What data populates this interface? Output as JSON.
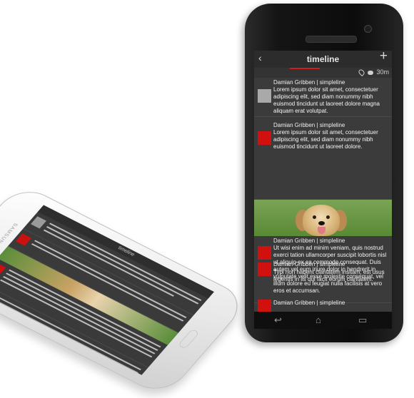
{
  "app": {
    "title": "timeline",
    "back_icon": "back-arrow-icon",
    "add_label": "+",
    "meta_time": "30m"
  },
  "posts": [
    {
      "author": "Damian Gribben | simpleline",
      "text": "Lorem ipsum dolor sit amet, consectetuer adipiscing elit, sed diam nonummy nibh euismod tincidunt ut laoreet dolore magna aliquam erat volutpat.",
      "avatar": "grey"
    },
    {
      "author": "Damian Gribben | simpleline",
      "text": "Lorem ipsum dolor sit amet, consectetuer adipiscing elit, sed diam nonummy nibh euismod tincidunt ut laoreet dolore.",
      "avatar": "red"
    },
    {
      "author": "Damian Gribben | simpleline",
      "text": "Ut wisi enim ad minim veniam, quis nostrud exerci tation ullamcorper suscipit lobortis nisl ut aliquip ex ea commodo consequat. Duis autem vel eum iriure dolor in hendrerit in vulputate velit esse molestie consequat, vel illum dolore eu feugiat nulla facilisis at vero eros et accumsan.",
      "avatar": "red"
    },
    {
      "author": "Damian Gribben | simpleline",
      "text": "Typi non habent claritatem insitam; est usus legentis in iis qui facit eorum claritatem.",
      "avatar": "red"
    },
    {
      "author": "Damian Gribben | simpleline",
      "text": "",
      "avatar": "red"
    }
  ],
  "back_phone": {
    "brand": "SAMSUNG"
  },
  "colors": {
    "accent": "#d01e1e",
    "screen_bg": "#3b3b3b",
    "appbar_bg": "#2c2c2c"
  },
  "navbar": {
    "back_icon": "nav-back-icon",
    "home_icon": "nav-home-icon",
    "recents_icon": "nav-recents-icon"
  }
}
